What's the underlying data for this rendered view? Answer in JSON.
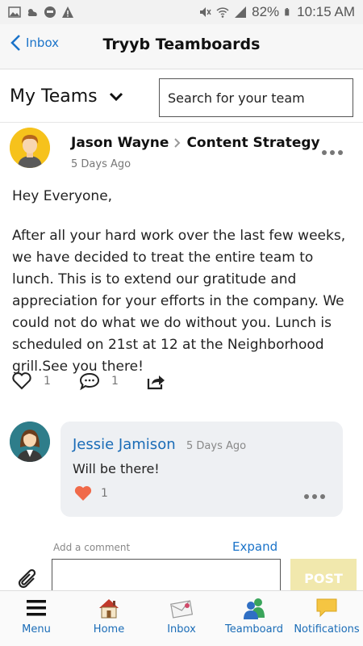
{
  "status_bar": {
    "battery": "82%",
    "time": "10:15 AM"
  },
  "header": {
    "back_label": "Inbox",
    "title": "Tryyb Teamboards"
  },
  "team_selector": {
    "label": "My Teams",
    "search_placeholder": "Search for your team"
  },
  "post": {
    "author": "Jason Wayne",
    "team": "Content Strategy",
    "time": "5 Days Ago",
    "greeting": "Hey Everyone,",
    "body": "After all your hard work over the last few weeks, we have decided to treat the entire team to lunch. This is to extend our gratitude and appreciation for your efforts in the company. We could not do what we do without you. Lunch is scheduled on 21st at 12 at the Neighborhood grill.See you there!",
    "likes": "1",
    "comments": "1"
  },
  "comment": {
    "author": "Jessie Jamison",
    "time": "5 Days Ago",
    "text": "Will be there!",
    "likes": "1"
  },
  "composer": {
    "label": "Add a comment",
    "expand": "Expand",
    "post_button": "POST"
  },
  "bottom_nav": {
    "items": [
      {
        "label": "Menu",
        "icon": "menu-icon"
      },
      {
        "label": "Home",
        "icon": "home-icon"
      },
      {
        "label": "Inbox",
        "icon": "inbox-icon"
      },
      {
        "label": "Teamboard",
        "icon": "teamboard-icon"
      },
      {
        "label": "Notifications",
        "icon": "notifications-icon"
      }
    ]
  },
  "colors": {
    "accent": "#1a73c9",
    "like_red": "#f06a4a",
    "post_button_bg": "#f1e8ad",
    "avatar_yellow": "#f6c21c"
  }
}
